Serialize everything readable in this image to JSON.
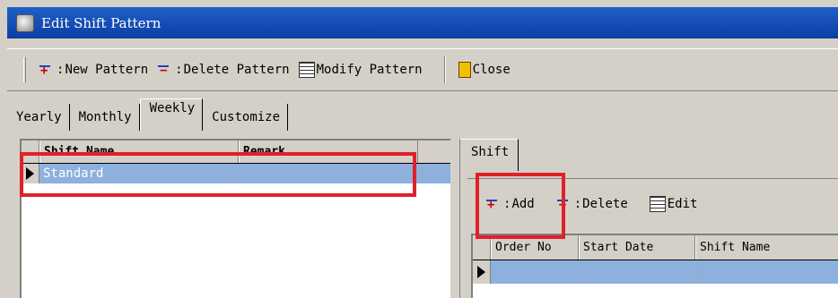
{
  "window": {
    "title": "Edit Shift Pattern"
  },
  "toolbar": {
    "new_pattern": "New Pattern",
    "delete_pattern": "Delete Pattern",
    "modify_pattern": "Modify Pattern",
    "close": "Close"
  },
  "tabs": [
    {
      "label": "Yearly"
    },
    {
      "label": "Monthly"
    },
    {
      "label": "Weekly",
      "active": true
    },
    {
      "label": "Customize"
    }
  ],
  "shift_pattern_grid": {
    "columns": [
      "Shift Name",
      "Remark"
    ],
    "rows": [
      {
        "shift_name": "Standard",
        "remark": ""
      }
    ]
  },
  "shift_panel": {
    "tab_label": "Shift",
    "add": "Add",
    "delete": "Delete",
    "edit": "Edit",
    "columns": [
      "Order No",
      "Start Date",
      "Shift Name"
    ]
  },
  "colors": {
    "selected_row": "#8db0dd",
    "highlight_box": "#e0202a",
    "title_bar": "#1f5fc9"
  }
}
